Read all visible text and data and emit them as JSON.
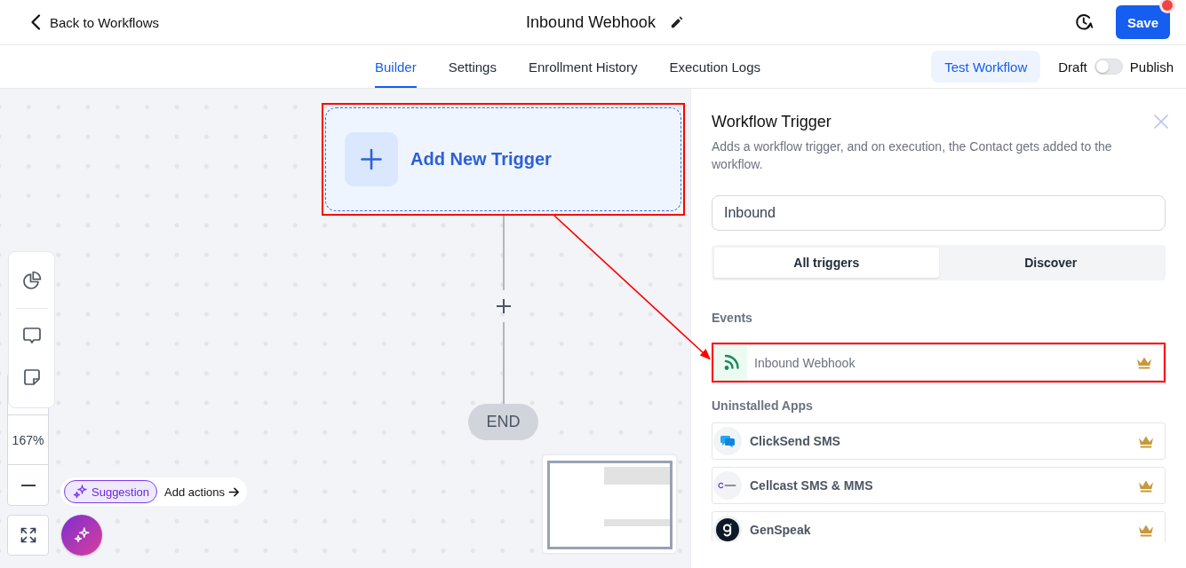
{
  "header": {
    "back_link": "Back to Workflows",
    "title": "Inbound Webhook",
    "save_button": "Save",
    "unsaved_changes": true
  },
  "tabs": [
    {
      "label": "Builder",
      "selected": true
    },
    {
      "label": "Settings",
      "selected": false
    },
    {
      "label": "Enrollment History",
      "selected": false
    },
    {
      "label": "Execution Logs",
      "selected": false
    }
  ],
  "test_button": "Test Workflow",
  "publish_toggle": {
    "off_label": "Draft",
    "on_label": "Publish",
    "on": false
  },
  "canvas": {
    "trigger_node": {
      "label": "Add New Trigger",
      "highlighted": true
    },
    "end_node": "END",
    "zoom_level": "167%",
    "suggestion": {
      "chip": "Suggestion",
      "action": "Add actions"
    }
  },
  "panel": {
    "title": "Workflow Trigger",
    "description": "Adds a workflow trigger, and on execution, the Contact gets added to the workflow.",
    "search": {
      "value": "Inbound"
    },
    "filters": [
      {
        "label": "All triggers",
        "selected": true
      },
      {
        "label": "Discover",
        "selected": false
      }
    ],
    "sections": [
      {
        "heading": "Events",
        "kind": "events",
        "items": [
          {
            "name": "Inbound Webhook",
            "kind": "rss",
            "premium": true,
            "highlighted": true
          }
        ]
      },
      {
        "heading": "Uninstalled Apps",
        "kind": "apps",
        "items": [
          {
            "name": "ClickSend SMS",
            "kind": "chat",
            "premium": true,
            "highlighted": false
          },
          {
            "name": "Cellcast SMS & MMS",
            "kind": "cellcast",
            "premium": true,
            "highlighted": false
          },
          {
            "name": "GenSpeak",
            "kind": "genspeak",
            "premium": true,
            "highlighted": false
          }
        ]
      }
    ]
  }
}
